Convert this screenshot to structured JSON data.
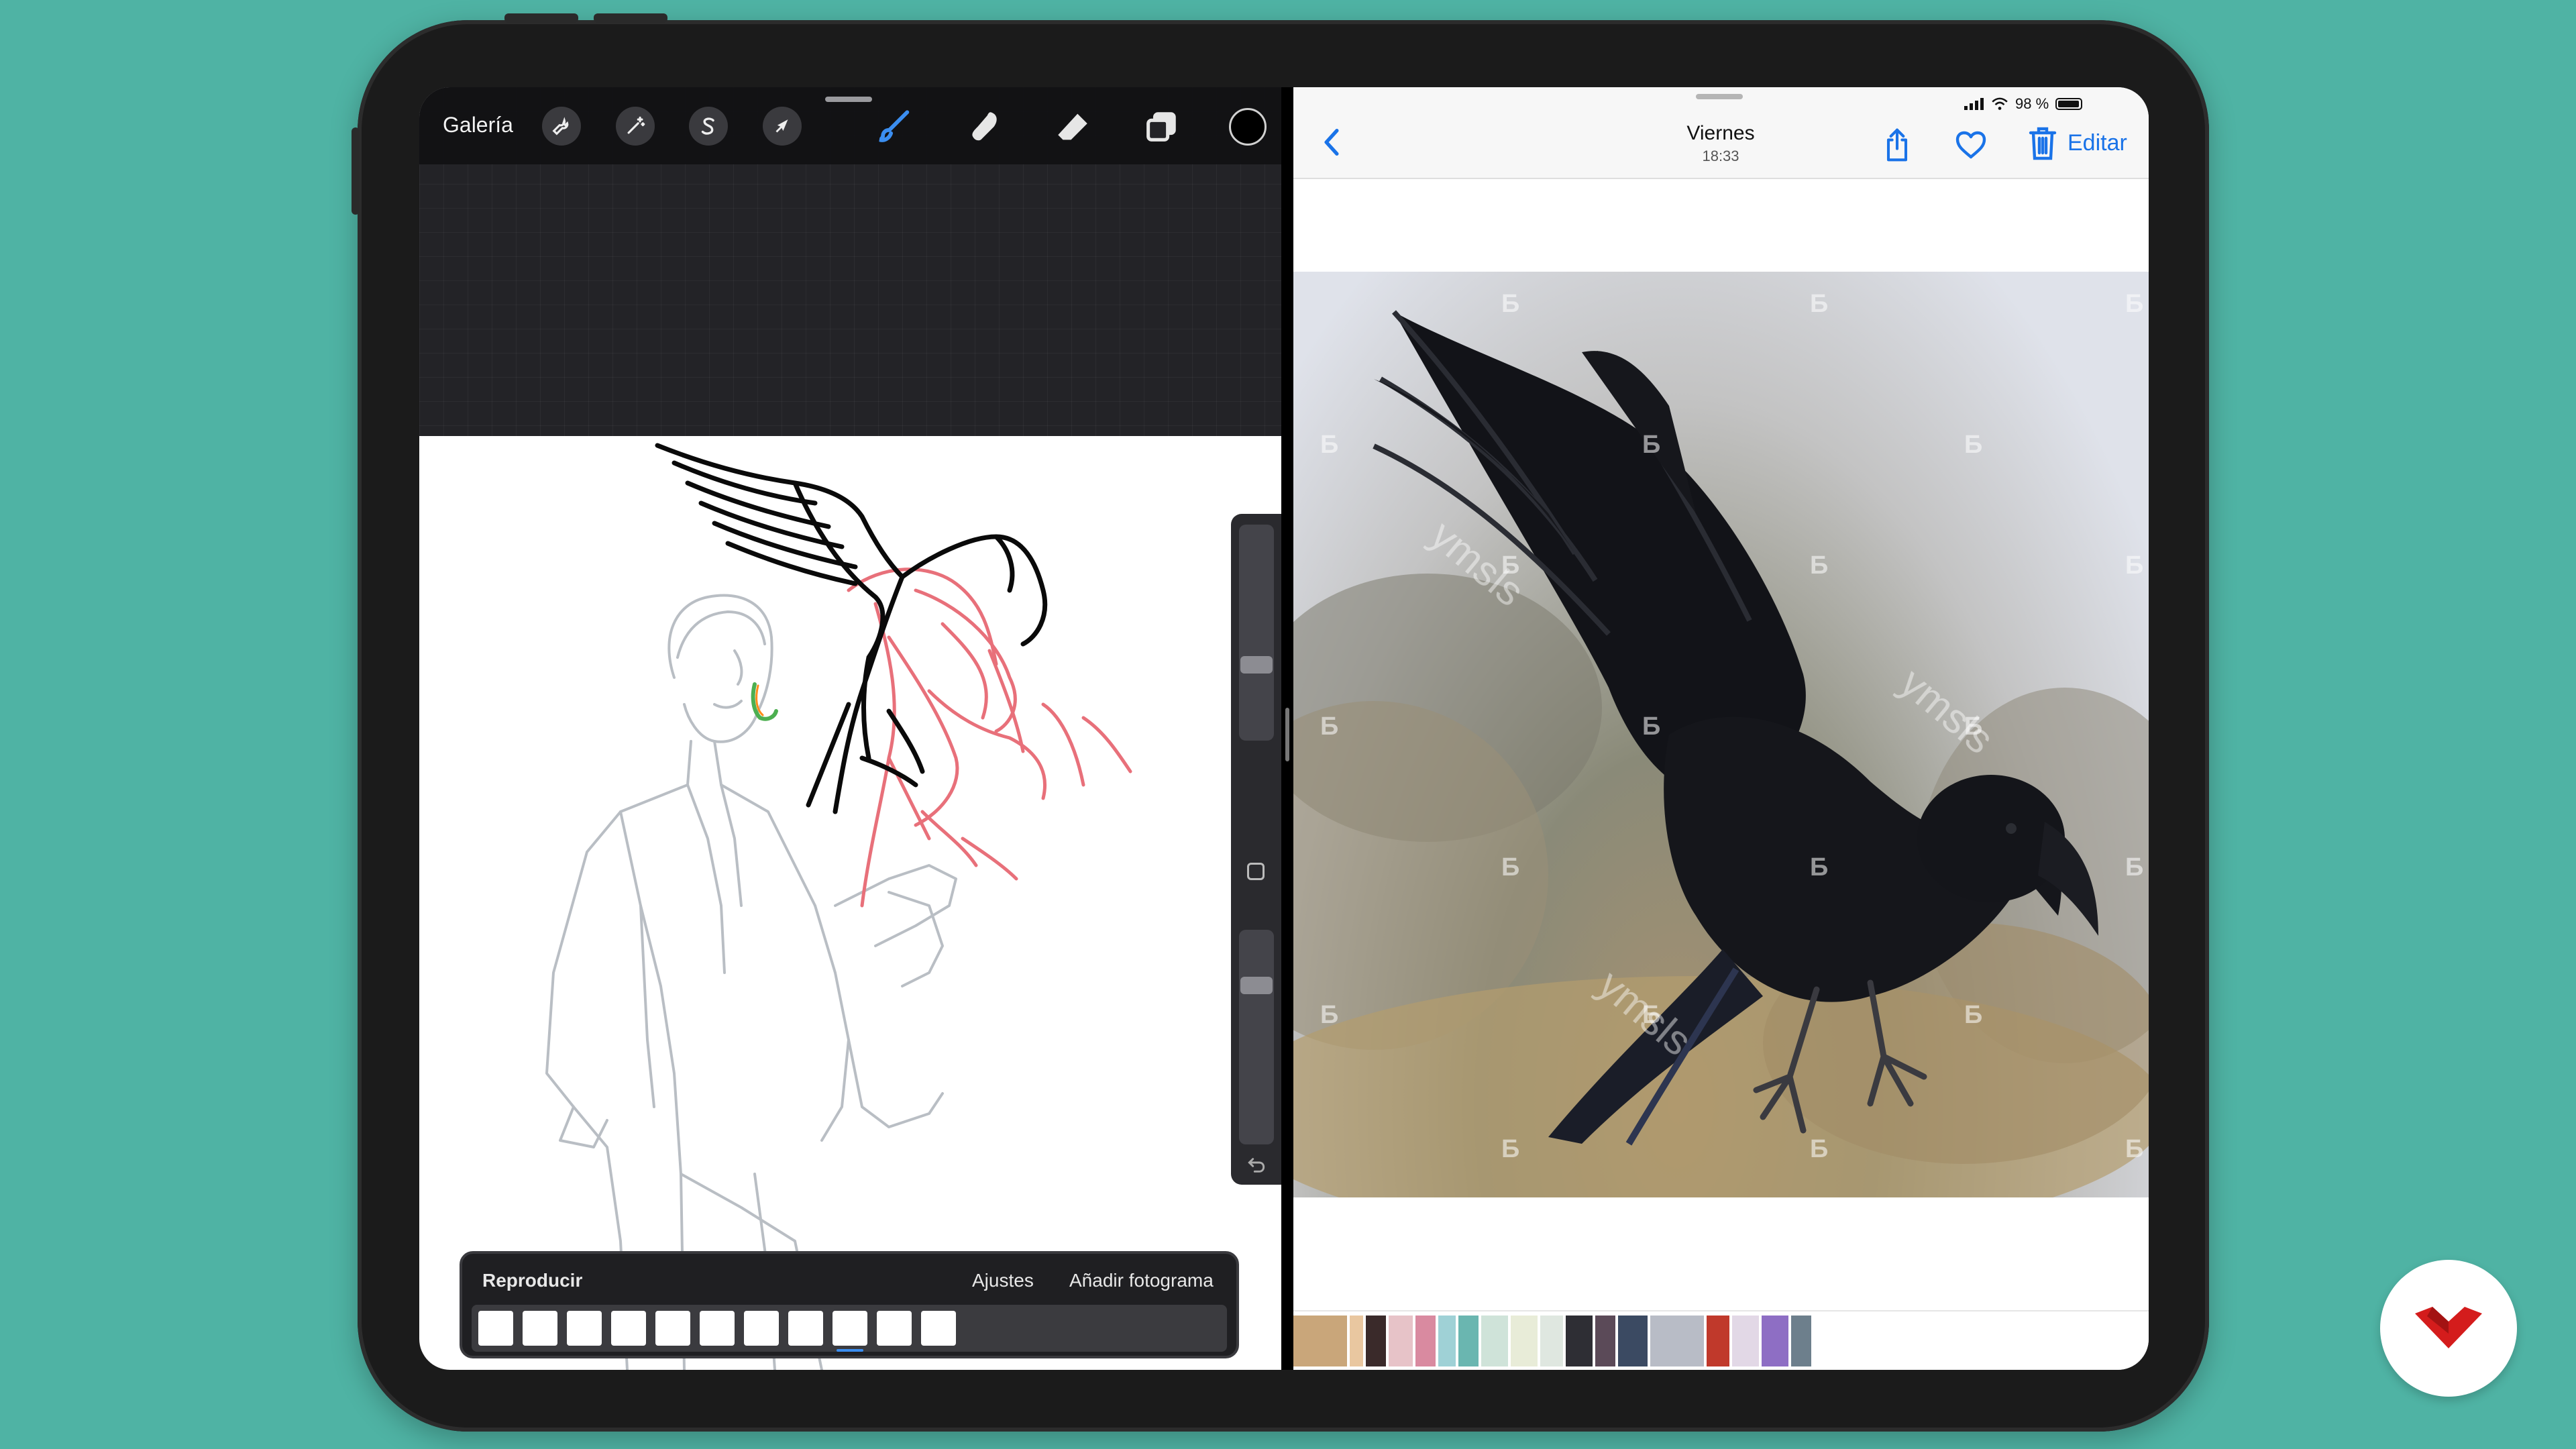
{
  "procreate": {
    "gallery_label": "Galería",
    "tools": {
      "actions_icon": "wrench-icon",
      "adjustments_icon": "magic-wand-icon",
      "selection_icon": "selection-s-icon",
      "transform_icon": "arrow-cursor-icon",
      "brush_icon": "brush-icon",
      "smudge_icon": "smudge-icon",
      "eraser_icon": "eraser-icon",
      "layers_icon": "layers-icon"
    },
    "current_color": "#000000",
    "animation": {
      "play_label": "Reproducir",
      "settings_label": "Ajustes",
      "add_frame_label": "Añadir fotograma",
      "frame_count": 11,
      "selected_frame_index": 8
    }
  },
  "photos": {
    "status": {
      "battery": "98 %"
    },
    "header": {
      "title": "Viernes",
      "time": "18:33",
      "edit_label": "Editar"
    },
    "watermark": "ymsls",
    "stamp": "Б"
  },
  "colors": {
    "background": "#4fb3a4",
    "accent_blue": "#1a73e8",
    "sketch_red": "#e8707a"
  }
}
